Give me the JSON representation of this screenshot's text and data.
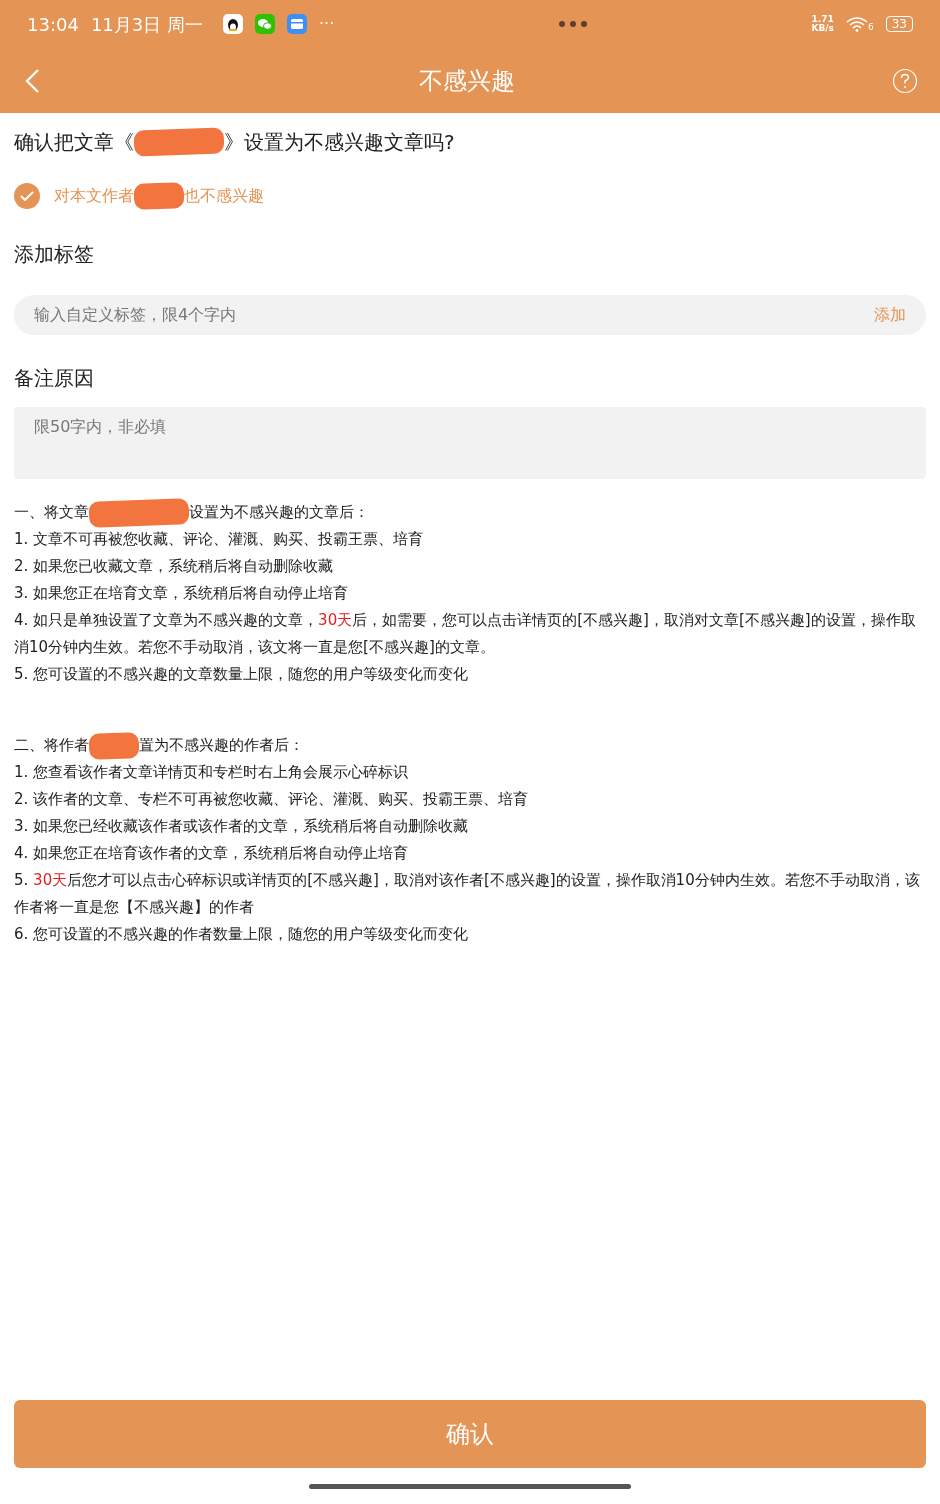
{
  "status_bar": {
    "time": "13:04",
    "date": "11月3日 周一",
    "more": "···",
    "speed_value": "1.71",
    "speed_unit": "KB/s",
    "wifi_label": "6",
    "battery": "33"
  },
  "nav": {
    "title": "不感兴趣"
  },
  "question": {
    "before": "确认把文章《",
    "after": "》设置为不感兴趣文章吗?"
  },
  "author_option": {
    "before": "对本文作者",
    "after": "也不感兴趣",
    "checked": true
  },
  "tags": {
    "title": "添加标签",
    "placeholder": "输入自定义标签，限4个字内",
    "add": "添加"
  },
  "note": {
    "title": "备注原因",
    "placeholder": "限50字内，非必填"
  },
  "sections": [
    {
      "heading_before": "一、将文章",
      "heading_after": "设置为不感兴趣的文章后：",
      "items": [
        [
          {
            "text": "1. 文章不可再被您收藏、评论、灌溉、购买、投霸王票、培育",
            "highlight": false
          }
        ],
        [
          {
            "text": "2. 如果您已收藏文章，系统稍后将自动删除收藏",
            "highlight": false
          }
        ],
        [
          {
            "text": "3. 如果您正在培育文章，系统稍后将自动停止培育",
            "highlight": false
          }
        ],
        [
          {
            "text": "4. 如只是单独设置了文章为不感兴趣的文章，",
            "highlight": false
          },
          {
            "text": "30天",
            "highlight": true
          },
          {
            "text": "后，如需要，您可以点击详情页的[不感兴趣]，取消对文章[不感兴趣]的设置，操作取消10分钟内生效。若您不手动取消，该文将一直是您[不感兴趣]的文章。",
            "highlight": false
          }
        ],
        [
          {
            "text": "5. 您可设置的不感兴趣的文章数量上限，随您的用户等级变化而变化",
            "highlight": false
          }
        ]
      ]
    },
    {
      "heading_before": "二、将作者",
      "heading_after": "置为不感兴趣的作者后：",
      "items": [
        [
          {
            "text": "1. 您查看该作者文章详情页和专栏时右上角会展示心碎标识",
            "highlight": false
          }
        ],
        [
          {
            "text": "2. 该作者的文章、专栏不可再被您收藏、评论、灌溉、购买、投霸王票、培育",
            "highlight": false
          }
        ],
        [
          {
            "text": "3. 如果您已经收藏该作者或该作者的文章，系统稍后将自动删除收藏",
            "highlight": false
          }
        ],
        [
          {
            "text": "4. 如果您正在培育该作者的文章，系统稍后将自动停止培育",
            "highlight": false
          }
        ],
        [
          {
            "text": "5. ",
            "highlight": false
          },
          {
            "text": "30天",
            "highlight": true
          },
          {
            "text": "后您才可以点击心碎标识或详情页的[不感兴趣]，取消对该作者[不感兴趣]的设置，操作取消10分钟内生效。若您不手动取消，该作者将一直是您【不感兴趣】的作者",
            "highlight": false
          }
        ],
        [
          {
            "text": "6. 您可设置的不感兴趣的作者数量上限，随您的用户等级变化而变化",
            "highlight": false
          }
        ]
      ]
    }
  ],
  "confirm_button": "确认"
}
